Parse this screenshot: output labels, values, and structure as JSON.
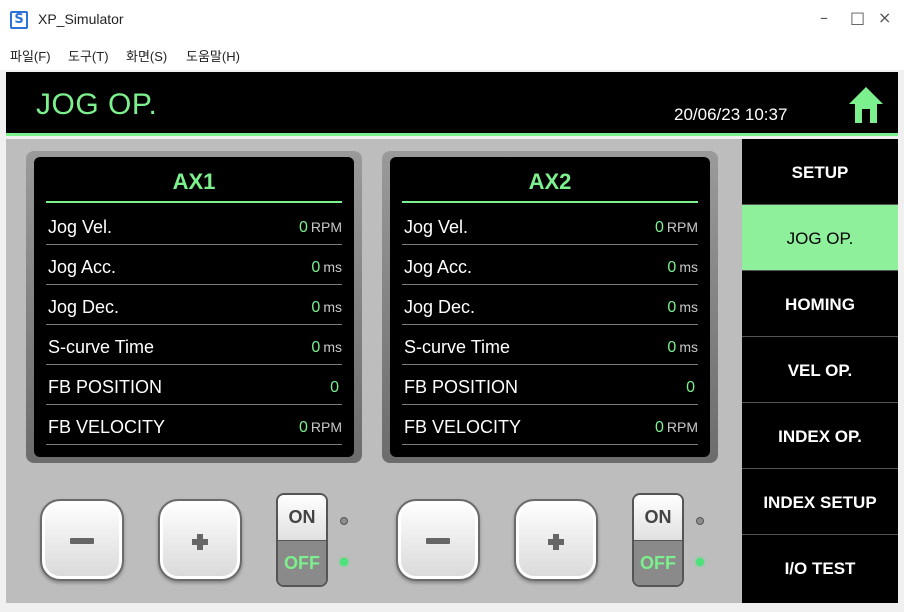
{
  "window": {
    "title": "XP_Simulator",
    "icon_letter": "S",
    "minimize": "–",
    "maximize": "□",
    "close": "×"
  },
  "menu": [
    "파일(F)",
    "도구(T)",
    "화면(S)",
    "도움말(H)"
  ],
  "header": {
    "title": "JOG OP.",
    "datetime": "20/06/23 10:37",
    "home_icon": "home-icon"
  },
  "axes": [
    {
      "title": "AX1",
      "rows": [
        {
          "label": "Jog Vel.",
          "value": "0",
          "unit": "RPM"
        },
        {
          "label": "Jog Acc.",
          "value": "0",
          "unit": "ms"
        },
        {
          "label": "Jog Dec.",
          "value": "0",
          "unit": "ms"
        },
        {
          "label": "S-curve Time",
          "value": "0",
          "unit": "ms"
        },
        {
          "label": "FB POSITION",
          "value": "0",
          "unit": ""
        },
        {
          "label": "FB VELOCITY",
          "value": "0",
          "unit": "RPM"
        }
      ],
      "toggle": {
        "on": "ON",
        "off": "OFF",
        "state": "off"
      }
    },
    {
      "title": "AX2",
      "rows": [
        {
          "label": "Jog Vel.",
          "value": "0",
          "unit": "RPM"
        },
        {
          "label": "Jog Acc.",
          "value": "0",
          "unit": "ms"
        },
        {
          "label": "Jog Dec.",
          "value": "0",
          "unit": "ms"
        },
        {
          "label": "S-curve Time",
          "value": "0",
          "unit": "ms"
        },
        {
          "label": "FB POSITION",
          "value": "0",
          "unit": ""
        },
        {
          "label": "FB VELOCITY",
          "value": "0",
          "unit": "RPM"
        }
      ],
      "toggle": {
        "on": "ON",
        "off": "OFF",
        "state": "off"
      }
    }
  ],
  "side_menu": [
    {
      "label": "SETUP",
      "active": false
    },
    {
      "label": "JOG OP.",
      "active": true
    },
    {
      "label": "HOMING",
      "active": false
    },
    {
      "label": "VEL OP.",
      "active": false
    },
    {
      "label": "INDEX OP.",
      "active": false
    },
    {
      "label": "INDEX SETUP",
      "active": false
    },
    {
      "label": "I/O TEST",
      "active": false
    }
  ],
  "colors": {
    "accent": "#7cf08d",
    "active_menu": "#8ef09a",
    "header_bg": "#000000",
    "led_on": "#4be37a"
  }
}
